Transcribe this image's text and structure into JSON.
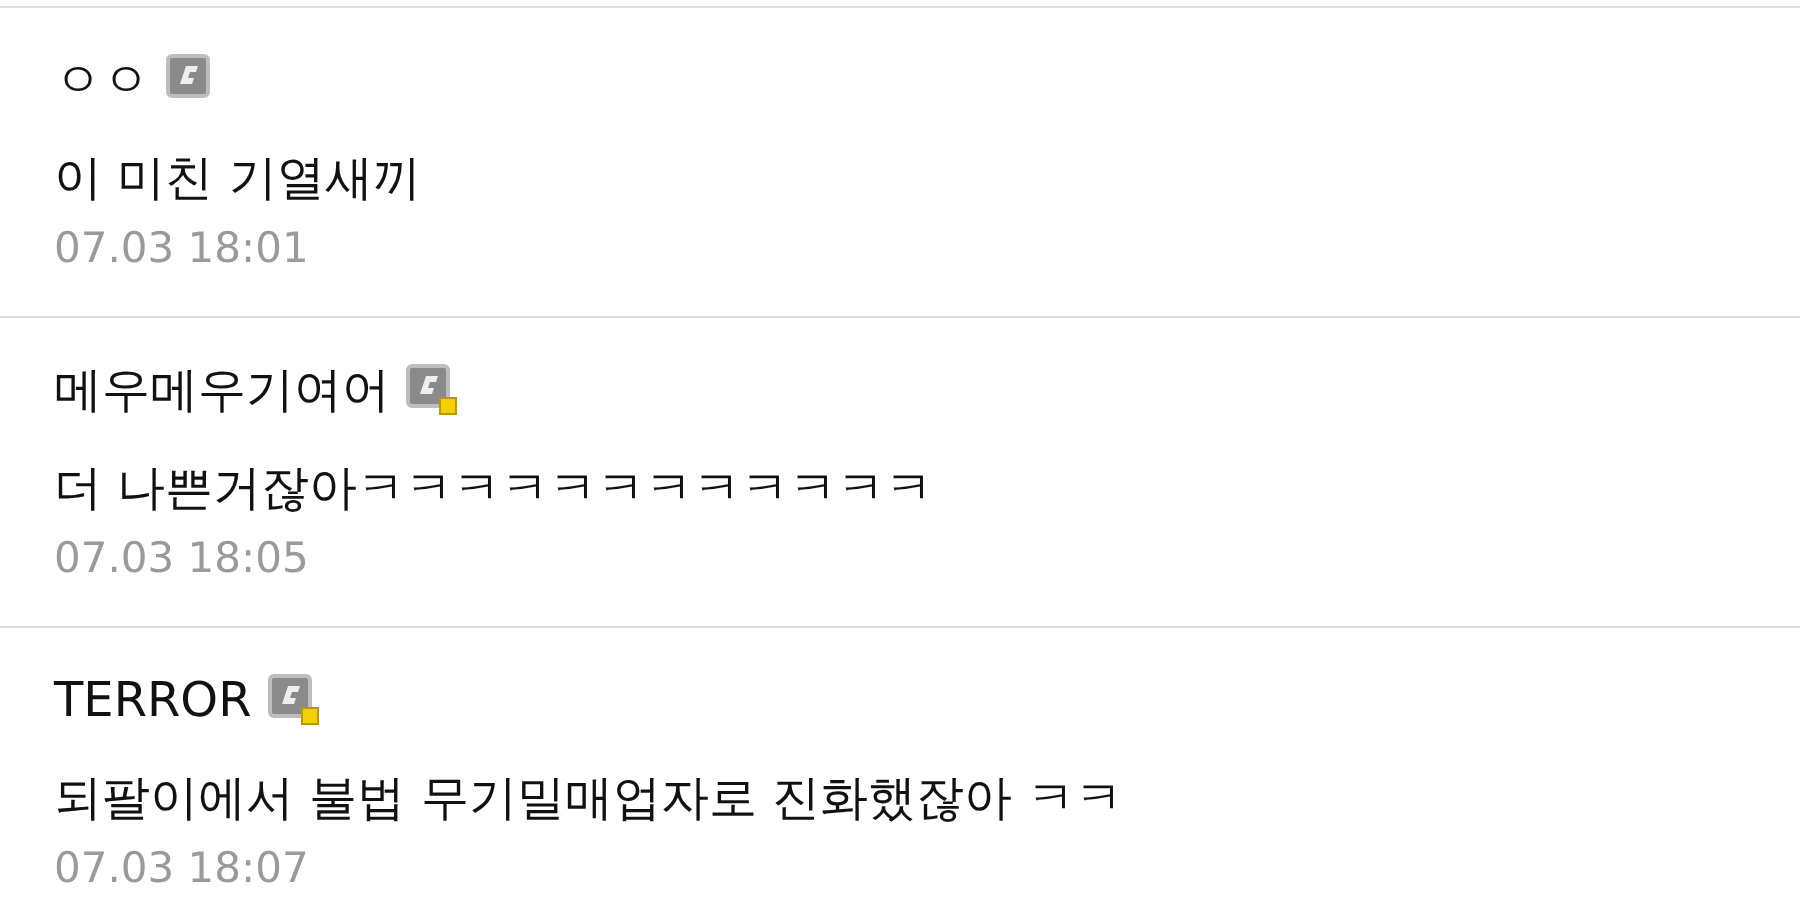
{
  "comments": [
    {
      "author": "ㅇㅇ",
      "marked": false,
      "text": "이 미친 기열새끼",
      "time": "07.03 18:01"
    },
    {
      "author": "메우메우기여어",
      "marked": true,
      "text": "더 나쁜거잖아ㅋㅋㅋㅋㅋㅋㅋㅋㅋㅋㅋㅋ",
      "time": "07.03 18:05"
    },
    {
      "author": "TERROR",
      "marked": true,
      "text": "되팔이에서 불법 무기밀매업자로 진화했잖아 ㅋㅋ",
      "time": "07.03 18:07"
    }
  ]
}
